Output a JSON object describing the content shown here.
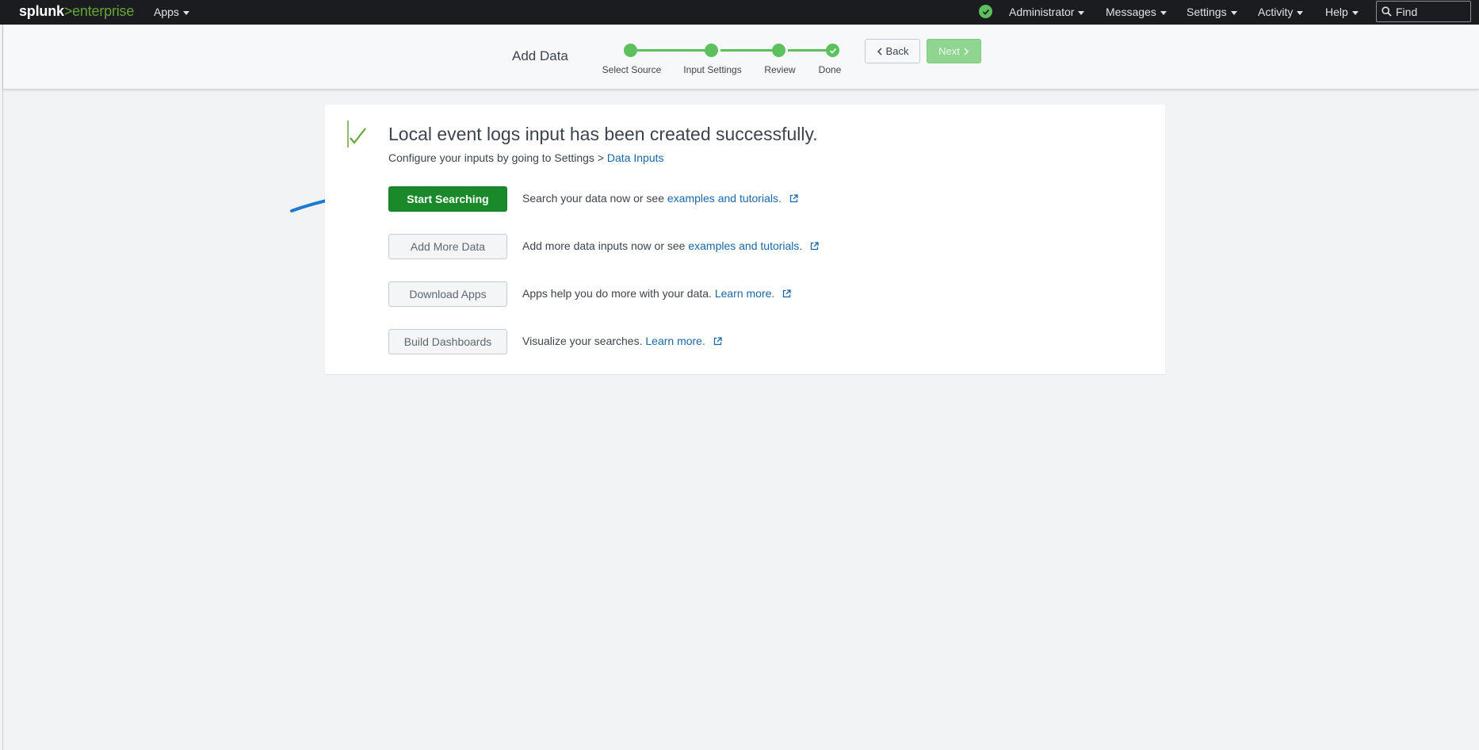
{
  "topbar": {
    "logo_part1": "splunk",
    "logo_part2": ">",
    "logo_part3": "enterprise",
    "apps_label": "Apps",
    "menus": [
      "Administrator",
      "Messages",
      "Settings",
      "Activity",
      "Help"
    ],
    "find_placeholder": "Find",
    "health_icon": "check-circle-icon"
  },
  "header": {
    "title": "Add Data",
    "steps": [
      "Select Source",
      "Input Settings",
      "Review",
      "Done"
    ],
    "back_label": "Back",
    "next_label": "Next"
  },
  "result": {
    "title": "Local event logs input has been created successfully.",
    "sub_text": "Configure your inputs by going to Settings > ",
    "sub_link": "Data Inputs",
    "actions": [
      {
        "button": "Start Searching",
        "desc": "Search your data now or see ",
        "link": "examples and tutorials."
      },
      {
        "button": "Add More Data",
        "desc": "Add more data inputs now or see ",
        "link": "examples and tutorials."
      },
      {
        "button": "Download Apps",
        "desc": "Apps help you do more with your data. ",
        "link": "Learn more."
      },
      {
        "button": "Build Dashboards",
        "desc": "Visualize your searches. ",
        "link": "Learn more."
      }
    ]
  },
  "colors": {
    "topbar_bg": "#1a1c20",
    "accent_green": "#5cc05c",
    "primary_button": "#1a8929",
    "link": "#1a66a8",
    "annotation": "#1a7ad4"
  }
}
